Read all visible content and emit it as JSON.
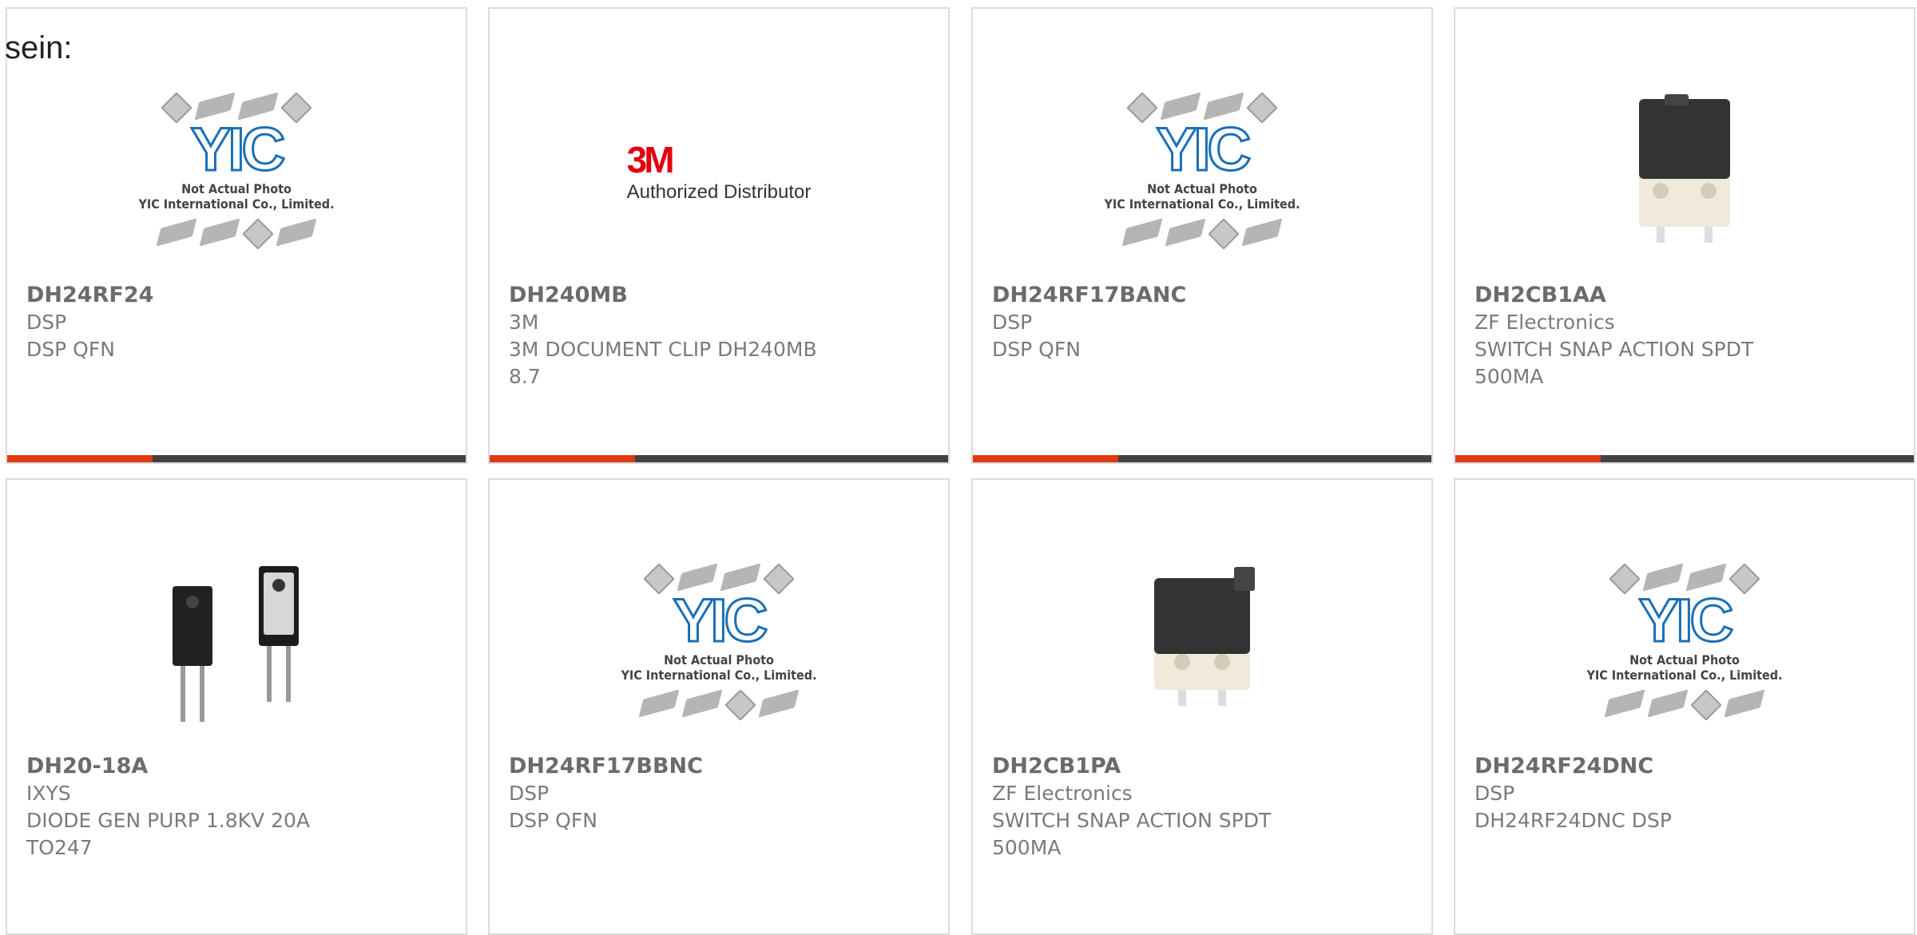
{
  "fragment_text": "sein:",
  "colors": {
    "accent": "#e03a12",
    "bar": "#424242",
    "border": "#dcdcdc"
  },
  "placeholder": {
    "line1": "Not Actual Photo",
    "line2": "YIC International Co., Limited.",
    "logo": "YIC"
  },
  "logo_3m": {
    "mark": "3M",
    "tagline": "Authorized Distributor"
  },
  "products": [
    {
      "part": "DH24RF24",
      "manufacturer": "DSP",
      "description": "DSP QFN",
      "image": "placeholder"
    },
    {
      "part": "DH240MB",
      "manufacturer": "3M",
      "description": "3M DOCUMENT CLIP DH240MB",
      "extra": "8.7",
      "image": "3m-logo"
    },
    {
      "part": "DH24RF17BANC",
      "manufacturer": "DSP",
      "description": "DSP QFN",
      "image": "placeholder"
    },
    {
      "part": "DH2CB1AA",
      "manufacturer": "ZF Electronics",
      "description": "SWITCH SNAP ACTION SPDT",
      "extra": "500MA",
      "image": "snap-switch"
    },
    {
      "part": "DH20-18A",
      "manufacturer": "IXYS",
      "description": "DIODE GEN PURP 1.8KV 20A",
      "extra": "TO247",
      "image": "diode-to247"
    },
    {
      "part": "DH24RF17BBNC",
      "manufacturer": "DSP",
      "description": "DSP QFN",
      "image": "placeholder"
    },
    {
      "part": "DH2CB1PA",
      "manufacturer": "ZF Electronics",
      "description": "SWITCH SNAP ACTION SPDT",
      "extra": "500MA",
      "image": "snap-switch"
    },
    {
      "part": "DH24RF24DNC",
      "manufacturer": "DSP",
      "description": "DH24RF24DNC DSP",
      "image": "placeholder"
    }
  ]
}
